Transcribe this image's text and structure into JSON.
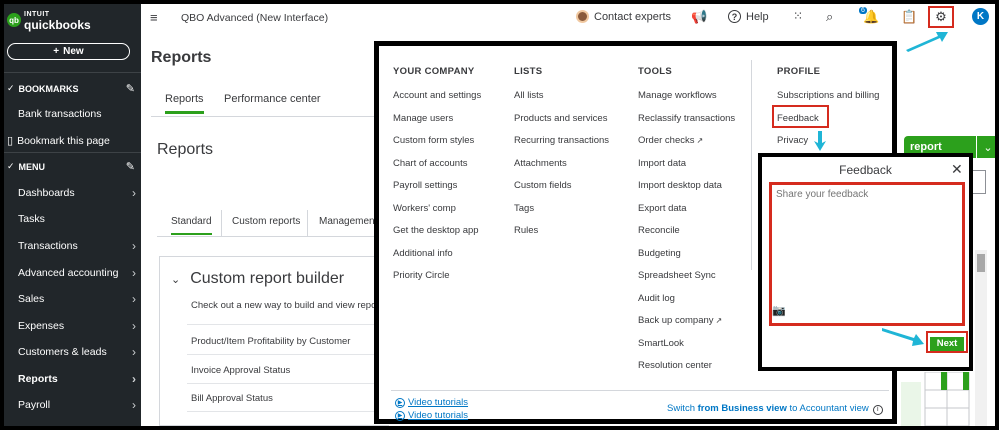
{
  "app": {
    "brand_top": "INTUIT",
    "brand_name": "quickbooks",
    "logo_glyph": "qb",
    "new_label": "New",
    "company_name": "QBO Advanced (New Interface)"
  },
  "sidebar": {
    "bookmarks_heading": "BOOKMARKS",
    "bookmarks": [
      "Bank transactions",
      "Bookmark this page"
    ],
    "menu_heading": "MENU",
    "items": [
      {
        "label": "Dashboards",
        "chevron": true
      },
      {
        "label": "Tasks",
        "chevron": false
      },
      {
        "label": "Transactions",
        "chevron": true
      },
      {
        "label": "Advanced accounting",
        "chevron": true
      },
      {
        "label": "Sales",
        "chevron": true
      },
      {
        "label": "Expenses",
        "chevron": true
      },
      {
        "label": "Customers & leads",
        "chevron": true
      },
      {
        "label": "Reports",
        "chevron": true
      },
      {
        "label": "Payroll",
        "chevron": true
      }
    ]
  },
  "topbar": {
    "contact_label": "Contact experts",
    "help_label": "Help",
    "notification_count": "6",
    "user_initial": "K"
  },
  "main": {
    "page_title": "Reports",
    "tabs": [
      "Reports",
      "Performance center"
    ],
    "section_title": "Reports",
    "sub_tabs": [
      "Standard",
      "Custom reports",
      "Management"
    ],
    "crb_title": "Custom report builder",
    "crb_desc": "Check out a new way to build and view repo",
    "crb_rows": [
      "Product/Item Profitability by Customer",
      "Invoice Approval Status",
      "Bill Approval Status"
    ],
    "report_button": "report"
  },
  "settings_menu": {
    "columns": [
      {
        "heading": "YOUR COMPANY",
        "items": [
          "Account and settings",
          "Manage users",
          "Custom form styles",
          "Chart of accounts",
          "Payroll settings",
          "Workers' comp",
          "Get the desktop app",
          "Additional info",
          "Priority Circle"
        ]
      },
      {
        "heading": "LISTS",
        "items": [
          "All lists",
          "Products and services",
          "Recurring transactions",
          "Attachments",
          "Custom fields",
          "Tags",
          "Rules"
        ]
      },
      {
        "heading": "TOOLS",
        "items": [
          "Manage workflows",
          "Reclassify transactions",
          "Order checks",
          "Import data",
          "Import desktop data",
          "Export data",
          "Reconcile",
          "Budgeting",
          "Spreadsheet Sync",
          "Audit log",
          "Back up company",
          "SmartLook",
          "Resolution center"
        ]
      },
      {
        "heading": "PROFILE",
        "items": [
          "Subscriptions and billing",
          "Feedback",
          "Privacy"
        ]
      }
    ],
    "video_links": [
      "Video tutorials",
      "Video tutorials"
    ],
    "switch_prefix": "Switch ",
    "switch_from": "from Business view",
    "switch_suffix": " to Accountant view"
  },
  "feedback": {
    "title": "Feedback",
    "placeholder": "Share your feedback",
    "next_label": "Next"
  },
  "colors": {
    "sidebar_bg": "#21262a",
    "brand_green": "#2ca01c",
    "highlight_red": "#d52b1e",
    "link_blue": "#0077c5",
    "arrow_cyan": "#1fb5d6"
  }
}
